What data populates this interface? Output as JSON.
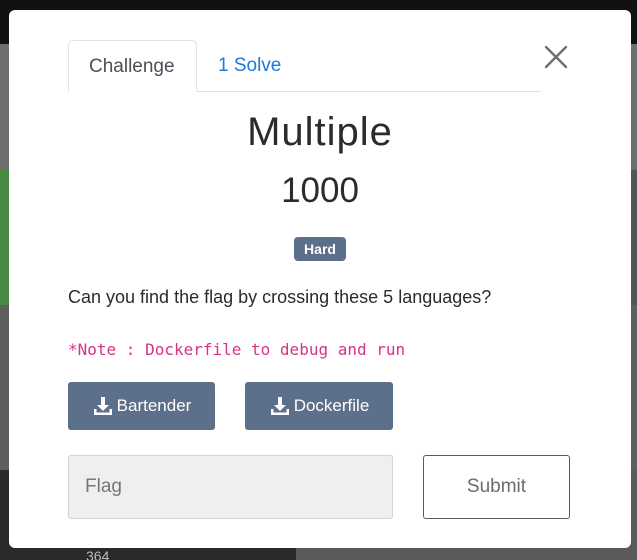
{
  "background": {
    "partial_text": "364"
  },
  "modal": {
    "tabs": [
      {
        "label": "Challenge",
        "active": true
      },
      {
        "label": "1 Solve",
        "active": false
      }
    ],
    "close_icon": "close-icon",
    "challenge": {
      "name": "Multiple",
      "points": "1000",
      "difficulty": "Hard",
      "description": "Can you find the flag by crossing these 5 languages?",
      "note": "*Note : Dockerfile to debug and run"
    },
    "files": [
      {
        "label": "Bartender",
        "icon": "download-icon"
      },
      {
        "label": "Dockerfile",
        "icon": "download-icon"
      }
    ],
    "flag_input": {
      "placeholder": "Flag",
      "value": ""
    },
    "submit_label": "Submit"
  },
  "colors": {
    "badge": "#5c6f8b",
    "file_button": "#5c6f8b",
    "tab_link": "#1a7ae0",
    "note": "#d63384"
  }
}
